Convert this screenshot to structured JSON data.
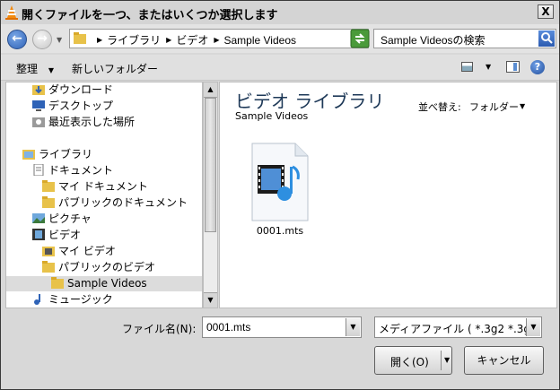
{
  "window": {
    "title": "開くファイルを一つ、またはいくつか選択します",
    "close_glyph": "X"
  },
  "navigation": {
    "breadcrumbs": [
      "ライブラリ",
      "ビデオ",
      "Sample Videos"
    ],
    "search_placeholder": "Sample Videosの検索"
  },
  "toolbar": {
    "organize_label": "整理",
    "new_folder_label": "新しいフォルダー"
  },
  "tree": [
    {
      "label": "ダウンロード",
      "icon": "download-folder-icon"
    },
    {
      "label": "デスクトップ",
      "icon": "desktop-icon"
    },
    {
      "label": "最近表示した場所",
      "icon": "recent-places-icon"
    },
    {
      "label": "ライブラリ",
      "icon": "libraries-icon"
    },
    {
      "label": "ドキュメント",
      "icon": "documents-icon"
    },
    {
      "label": "マイ ドキュメント",
      "icon": "folder-icon"
    },
    {
      "label": "パブリックのドキュメント",
      "icon": "folder-icon"
    },
    {
      "label": "ピクチャ",
      "icon": "pictures-icon"
    },
    {
      "label": "ビデオ",
      "icon": "videos-icon"
    },
    {
      "label": "マイ ビデオ",
      "icon": "folder-icon"
    },
    {
      "label": "パブリックのビデオ",
      "icon": "folder-icon"
    },
    {
      "label": "Sample Videos",
      "icon": "folder-icon",
      "selected": true
    },
    {
      "label": "ミュージック",
      "icon": "music-icon"
    }
  ],
  "content": {
    "library_title": "ビデオ ライブラリ",
    "library_subtitle": "Sample Videos",
    "arrange_label": "並べ替え:",
    "arrange_value": "フォルダー",
    "files": [
      {
        "name": "0001.mts",
        "icon": "video-file-icon"
      }
    ]
  },
  "footer": {
    "filename_label": "ファイル名(N):",
    "filename_value": "0001.mts",
    "filetype_value": "メディアファイル ( *.3g2 *.3g",
    "open_label": "開く(O)",
    "cancel_label": "キャンセル"
  },
  "colors": {
    "title_text": "#1e3958",
    "accent_blue": "#2f63b7",
    "selection": "#dcdcdc"
  }
}
